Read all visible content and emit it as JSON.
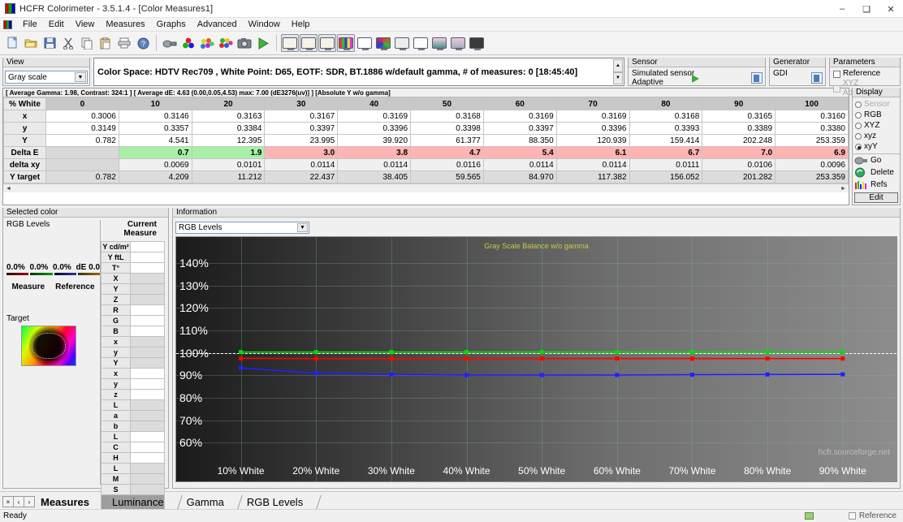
{
  "window": {
    "title": "HCFR Colorimeter - 3.5.1.4 - [Color Measures1]",
    "minimize": "–",
    "maximize": "❑",
    "close": "✕",
    "app_icon": "hcfr-logo-icon"
  },
  "menu": {
    "items": [
      "File",
      "Edit",
      "View",
      "Measures",
      "Graphs",
      "Advanced",
      "Window",
      "Help"
    ]
  },
  "toolbar": {
    "icons": [
      "new-document-icon",
      "open-folder-icon",
      "save-icon",
      "cut-scissors-icon",
      "copy-icon",
      "paste-icon",
      "print-icon",
      "help-question-icon",
      "measure-device-icon",
      "rgb-spheres-icon",
      "color-balls-icon",
      "color-cluster-icon",
      "camera-icon",
      "play-run-icon"
    ],
    "view_buttons": [
      "monitor-view-1-icon",
      "monitor-view-2-icon",
      "monitor-view-3-icon",
      "monitor-colorbars-icon",
      "monitor-blank-icon",
      "monitor-cie-icon",
      "monitor-gray-icon",
      "monitor-white-icon",
      "monitor-gradient-icon",
      "monitor-pattern-icon",
      "monitor-dark-icon"
    ]
  },
  "view": {
    "caption": "View",
    "selected": "Gray scale",
    "colorspace_text": "Color Space: HDTV Rec709 , White Point: D65, EOTF:  SDR, BT.1886 w/default gamma, # of measures: 0 [18:45:40]"
  },
  "sensor": {
    "caption": "Sensor",
    "line1": "Simulated sensor",
    "line2": "Adaptive"
  },
  "generator": {
    "caption": "Generator",
    "value": "GDI"
  },
  "parameters": {
    "caption": "Parameters",
    "reference_label": "Reference",
    "reference_checked": false,
    "xyz_label": "XYZ Adjustment",
    "xyz_checked": false,
    "xyz_disabled": true
  },
  "summary_tabs": "[ Average Gamma: 1.98, Contrast: 324:1 ] [ Average dE: 4.63 (0.00,0.05,4.53) max: 7.00 (dE3276(uv)] ] [Absolute Y w/o gamma]",
  "table": {
    "row_header": "% White",
    "columns": [
      "0",
      "10",
      "20",
      "30",
      "40",
      "50",
      "60",
      "70",
      "80",
      "90",
      "100"
    ],
    "rows": [
      {
        "label": "x",
        "type": "plain",
        "values": [
          "0.3006",
          "0.3146",
          "0.3163",
          "0.3167",
          "0.3169",
          "0.3168",
          "0.3169",
          "0.3169",
          "0.3168",
          "0.3165",
          "0.3160"
        ]
      },
      {
        "label": "y",
        "type": "plain",
        "values": [
          "0.3149",
          "0.3357",
          "0.3384",
          "0.3397",
          "0.3396",
          "0.3398",
          "0.3397",
          "0.3396",
          "0.3393",
          "0.3389",
          "0.3380"
        ]
      },
      {
        "label": "Y",
        "type": "plain",
        "values": [
          "0.782",
          "4.541",
          "12.395",
          "23.995",
          "39.920",
          "61.377",
          "88.350",
          "120.939",
          "159.414",
          "202.248",
          "253.359"
        ]
      },
      {
        "label": "Delta E",
        "type": "de",
        "values": [
          "",
          "0.7",
          "1.9",
          "3.0",
          "3.8",
          "4.7",
          "5.4",
          "6.1",
          "6.7",
          "7.0",
          "6.9"
        ],
        "flags": [
          "blank",
          "ok",
          "ok",
          "bad",
          "bad",
          "bad",
          "bad",
          "bad",
          "bad",
          "bad",
          "bad"
        ]
      },
      {
        "label": "delta xy",
        "type": "dxy",
        "values": [
          "",
          "0.0069",
          "0.0101",
          "0.0114",
          "0.0114",
          "0.0116",
          "0.0114",
          "0.0114",
          "0.0111",
          "0.0106",
          "0.0096"
        ],
        "flags": [
          "blank",
          "",
          "",
          "",
          "",
          "",
          "",
          "",
          "",
          "",
          ""
        ]
      },
      {
        "label": "Y target",
        "type": "yt",
        "values": [
          "0.782",
          "4.209",
          "11.212",
          "22.437",
          "38.405",
          "59.565",
          "84.970",
          "117.382",
          "156.052",
          "201.282",
          "253.359"
        ]
      }
    ]
  },
  "display_panel": {
    "caption": "Display",
    "options": [
      {
        "label": "Sensor",
        "selected": false,
        "disabled": true
      },
      {
        "label": "RGB",
        "selected": false,
        "disabled": false
      },
      {
        "label": "XYZ",
        "selected": false,
        "disabled": false
      },
      {
        "label": "xyz",
        "selected": false,
        "disabled": false
      },
      {
        "label": "xyY",
        "selected": true,
        "disabled": false
      }
    ],
    "buttons": [
      {
        "label": "Go",
        "icon": "measure-go-icon"
      },
      {
        "label": "Delete",
        "icon": "refresh-delete-icon"
      },
      {
        "label": "Refs",
        "icon": "references-bars-icon"
      }
    ],
    "edit_label": "Edit"
  },
  "selected_color": {
    "caption": "Selected color",
    "rgb_levels_label": "RGB Levels",
    "current_measure_label": "Current Measure",
    "percent_r": "0.0%",
    "percent_g": "0.0%",
    "percent_b": "0.0%",
    "de_label": "dE 0.0",
    "measure_label": "Measure",
    "reference_label": "Reference",
    "target_label": "Target",
    "target_icon": "cie-chromaticity-target-icon",
    "measure_rows": [
      {
        "label": "Y cd/m²",
        "shade": "w"
      },
      {
        "label": "Y ftL",
        "shade": "w"
      },
      {
        "label": "T°",
        "shade": "w"
      },
      {
        "label": "X",
        "shade": "g"
      },
      {
        "label": "Y",
        "shade": "g"
      },
      {
        "label": "Z",
        "shade": "g"
      },
      {
        "label": "R",
        "shade": "w"
      },
      {
        "label": "G",
        "shade": "w"
      },
      {
        "label": "B",
        "shade": "w"
      },
      {
        "label": "x",
        "shade": "g"
      },
      {
        "label": "y",
        "shade": "g"
      },
      {
        "label": "Y",
        "shade": "g"
      },
      {
        "label": "x",
        "shade": "w"
      },
      {
        "label": "y",
        "shade": "w"
      },
      {
        "label": "z",
        "shade": "w"
      },
      {
        "label": "L",
        "shade": "g"
      },
      {
        "label": "a",
        "shade": "g"
      },
      {
        "label": "b",
        "shade": "g"
      },
      {
        "label": "L",
        "shade": "w"
      },
      {
        "label": "C",
        "shade": "w"
      },
      {
        "label": "H",
        "shade": "w"
      },
      {
        "label": "L",
        "shade": "g"
      },
      {
        "label": "M",
        "shade": "g"
      },
      {
        "label": "S",
        "shade": "g"
      }
    ]
  },
  "information": {
    "caption": "Information",
    "graph_selected": "RGB Levels"
  },
  "chart_data": {
    "type": "line",
    "title": "Gray Scale Balance w/o gamma",
    "watermark": "hcfr.sourceforge.net",
    "xlabel": "",
    "ylabel": "",
    "categories": [
      "10% White",
      "20% White",
      "30% White",
      "40% White",
      "50% White",
      "60% White",
      "70% White",
      "80% White",
      "90% White"
    ],
    "yticks": [
      "60%",
      "70%",
      "80%",
      "90%",
      "100%",
      "110%",
      "120%",
      "130%",
      "140%"
    ],
    "ylim": [
      55,
      145
    ],
    "grid": true,
    "reference_line": 100,
    "legend_position": "none",
    "series": [
      {
        "name": "Red",
        "color": "#ff0000",
        "values": [
          97.5,
          97.4,
          97.4,
          97.4,
          97.4,
          97.4,
          97.4,
          97.4,
          97.4
        ]
      },
      {
        "name": "Green",
        "color": "#00e000",
        "values": [
          100.3,
          100.3,
          100.3,
          100.3,
          100.3,
          100.3,
          100.3,
          100.3,
          100.3
        ]
      },
      {
        "name": "Blue",
        "color": "#2020ff",
        "values": [
          93.2,
          90.9,
          90.3,
          90.1,
          90.1,
          90.1,
          90.2,
          90.3,
          90.4
        ]
      }
    ]
  },
  "bottom_tabs": {
    "nav": [
      "×",
      "‹",
      "›"
    ],
    "items": [
      {
        "label": "Measures",
        "active": true
      },
      {
        "label": "Luminance",
        "active": false
      },
      {
        "label": "Gamma",
        "active": false
      },
      {
        "label": "RGB Levels",
        "active": false
      }
    ]
  },
  "status": {
    "text": "Ready",
    "reference_label": "Reference",
    "reference_checked": false
  }
}
